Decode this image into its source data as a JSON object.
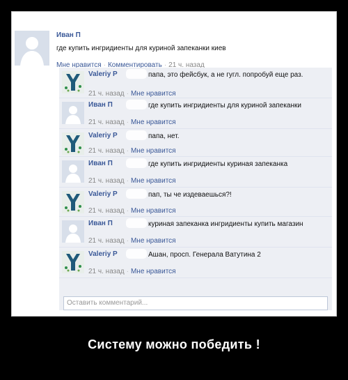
{
  "post": {
    "author": "Иван П",
    "text": "где купить ингридиенты для куриной запеканки киев",
    "like": "Мне нравится",
    "comment": "Комментировать",
    "time": "21 ч. назад"
  },
  "comments": [
    {
      "author": "Valeriy P",
      "text": "папа, это фейсбук, а не гугл. попробуй еще раз.",
      "time": "21 ч. назад",
      "like": "Мне нравится",
      "avatar": "valeriy-avatar"
    },
    {
      "author": "Иван П",
      "text": "где купить ингридиенты для куриной запеканки",
      "time": "21 ч. назад",
      "like": "Мне нравится",
      "avatar": "default-user-avatar"
    },
    {
      "author": "Valeriy P",
      "text": "папа, нет.",
      "time": "21 ч. назад",
      "like": "Мне нравится",
      "avatar": "valeriy-avatar"
    },
    {
      "author": "Иван П",
      "text": "где купить ингридиенты куриная запеканка",
      "time": "21 ч. назад",
      "like": "Мне нравится",
      "avatar": "default-user-avatar"
    },
    {
      "author": "Valeriy P",
      "text": "пап, ты че издеваешься?!",
      "time": "21 ч. назад",
      "like": "Мне нравится",
      "avatar": "valeriy-avatar"
    },
    {
      "author": "Иван П",
      "text": "куриная запеканка ингридиенты купить магазин",
      "time": "21 ч. назад",
      "like": "Мне нравится",
      "avatar": "default-user-avatar"
    },
    {
      "author": "Valeriy P",
      "text": "Ашан, просп. Генерала Ватутина 2",
      "time": "21 ч. назад",
      "like": "Мне нравится",
      "avatar": "valeriy-avatar"
    }
  ],
  "comment_input": {
    "placeholder": "Оставить комментарий..."
  },
  "caption": "Систему можно победить !",
  "colors": {
    "link": "#3b5998",
    "comment_bg": "#edeff4"
  }
}
